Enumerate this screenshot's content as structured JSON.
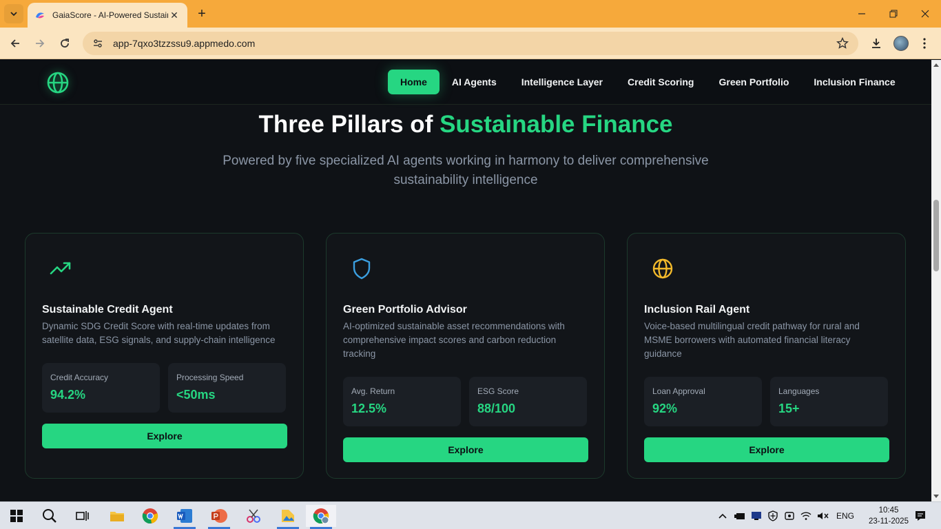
{
  "browser": {
    "tab_title": "GaiaScore - AI-Powered Sustain",
    "url": "app-7qxo3tzzssu9.appmedo.com"
  },
  "header": {
    "nav": [
      {
        "label": "Home"
      },
      {
        "label": "AI Agents"
      },
      {
        "label": "Intelligence Layer"
      },
      {
        "label": "Credit Scoring"
      },
      {
        "label": "Green Portfolio"
      },
      {
        "label": "Inclusion Finance"
      }
    ],
    "active_nav": "Home"
  },
  "hero": {
    "title_plain": "Three Pillars of ",
    "title_accent": "Sustainable Finance",
    "subtitle": "Powered by five specialized AI agents working in harmony to deliver comprehensive sustainability intelligence"
  },
  "cards": [
    {
      "icon": "trending-up-icon",
      "title": "Sustainable Credit Agent",
      "description": "Dynamic SDG Credit Score with real-time updates from satellite data, ESG signals, and supply-chain intelligence",
      "stats": [
        {
          "label": "Credit Accuracy",
          "value": "94.2%"
        },
        {
          "label": "Processing Speed",
          "value": "<50ms"
        }
      ],
      "button": "Explore"
    },
    {
      "icon": "shield-icon",
      "title": "Green Portfolio Advisor",
      "description": "AI-optimized sustainable asset recommendations with comprehensive impact scores and carbon reduction tracking",
      "stats": [
        {
          "label": "Avg. Return",
          "value": "12.5%"
        },
        {
          "label": "ESG Score",
          "value": "88/100"
        }
      ],
      "button": "Explore"
    },
    {
      "icon": "globe-icon",
      "title": "Inclusion Rail Agent",
      "description": "Voice-based multilingual credit pathway for rural and MSME borrowers with automated financial literacy guidance",
      "stats": [
        {
          "label": "Loan Approval",
          "value": "92%"
        },
        {
          "label": "Languages",
          "value": "15+"
        }
      ],
      "button": "Explore"
    }
  ],
  "colors": {
    "accent": "#26d682",
    "background": "#0f1216",
    "card_border": "#1c3a2c",
    "shield_icon": "#3b9fe0",
    "globe_icon": "#f2b92b"
  },
  "taskbar": {
    "language": "ENG",
    "time": "10:45",
    "date": "23-11-2025"
  }
}
